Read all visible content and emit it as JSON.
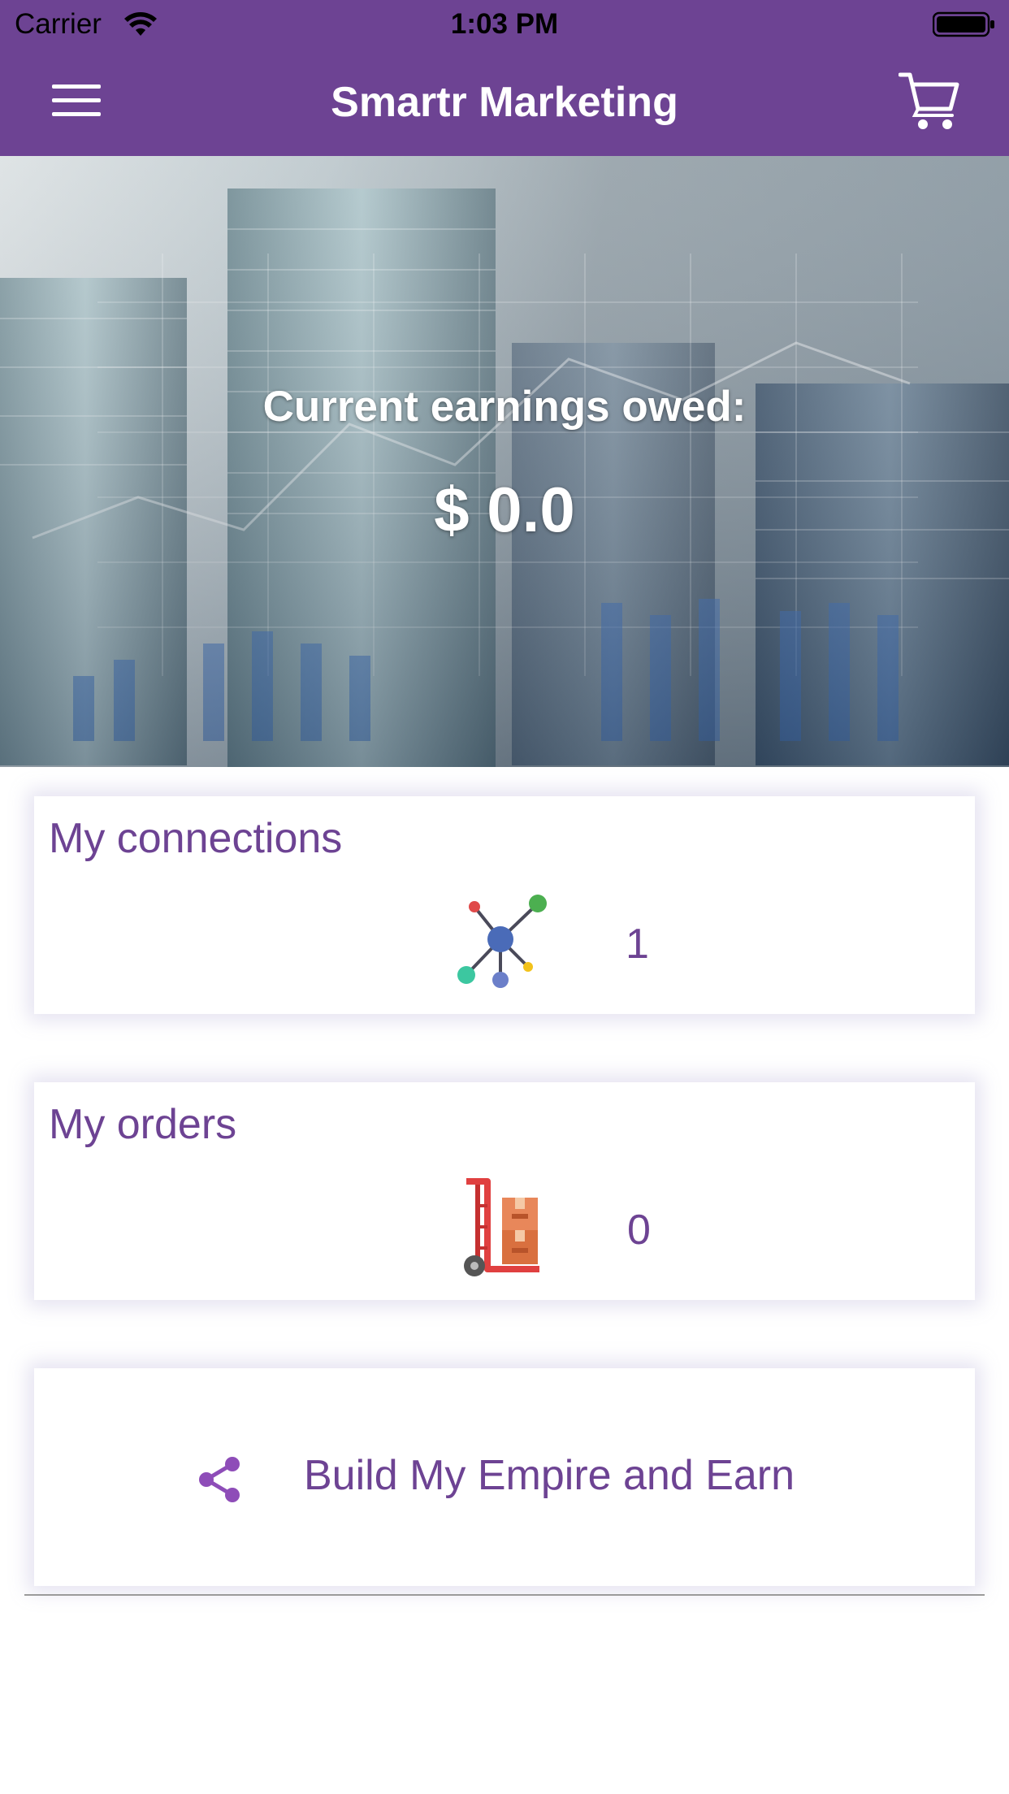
{
  "status_bar": {
    "carrier": "Carrier",
    "time": "1:03 PM",
    "wifi_icon": "wifi-icon",
    "battery_icon": "battery-icon"
  },
  "header": {
    "title": "Smartr Marketing",
    "menu_icon": "hamburger-menu-icon",
    "cart_icon": "shopping-cart-icon",
    "background_color": "#6d4393"
  },
  "hero": {
    "label": "Current earnings owed:",
    "amount": "$ 0.0",
    "image": "stacked-coins-financial-chart-background"
  },
  "cards": {
    "connections": {
      "title": "My connections",
      "icon": "network-nodes-icon",
      "value": "1"
    },
    "orders": {
      "title": "My orders",
      "icon": "hand-truck-boxes-icon",
      "value": "0"
    },
    "empire": {
      "label": "Build My Empire and Earn",
      "icon": "share-icon"
    }
  },
  "colors": {
    "accent": "#6d4393",
    "text_purple": "#6d4393",
    "card_background": "#ffffff"
  }
}
